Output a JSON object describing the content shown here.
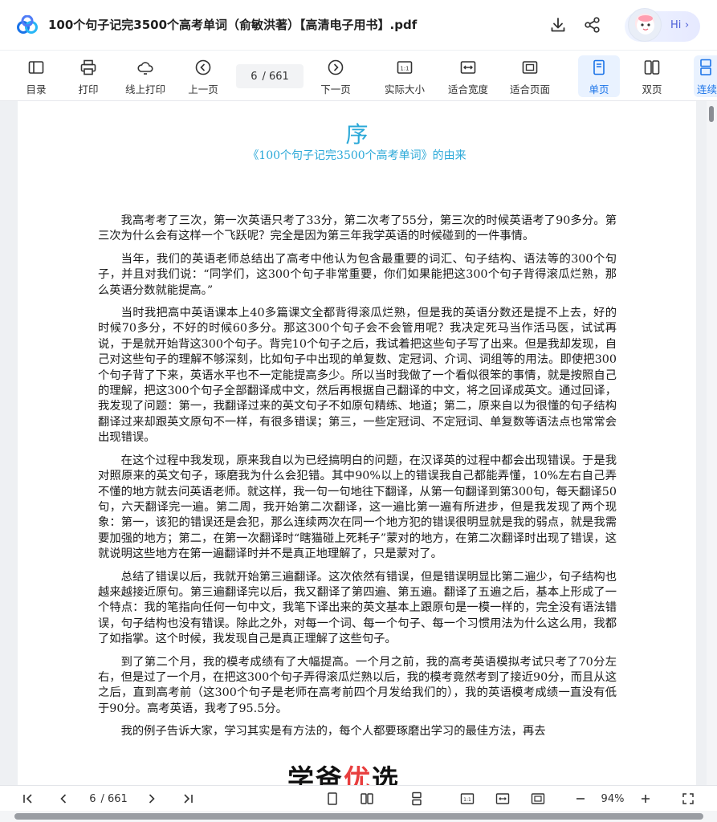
{
  "titlebar": {
    "title": "100个句子记完3500个高考单词（俞敏洪著）【高清电子用书】.pdf",
    "hi_label": "Hi",
    "hi_chevron": "›"
  },
  "toolbar": {
    "tools": [
      {
        "label": "目录",
        "icon": "toc-icon"
      },
      {
        "label": "打印",
        "icon": "printer-icon"
      },
      {
        "label": "线上打印",
        "icon": "cloud-print-icon"
      },
      {
        "label": "上一页",
        "icon": "prev-page-icon"
      },
      {
        "label": "下一页",
        "icon": "next-page-icon"
      },
      {
        "label": "实际大小",
        "icon": "actual-size-icon"
      },
      {
        "label": "适合宽度",
        "icon": "fit-width-icon"
      },
      {
        "label": "适合页面",
        "icon": "fit-page-icon"
      },
      {
        "label": "单页",
        "icon": "single-page-icon"
      },
      {
        "label": "双页",
        "icon": "double-page-icon"
      },
      {
        "label": "连续",
        "icon": "continuous-icon"
      }
    ],
    "current_page": "6",
    "total_pages": "/ 661",
    "active_tool": "单页"
  },
  "page": {
    "heading": "序",
    "subheading": "《100个句子记完3500个高考单词》的由来",
    "paragraphs": [
      "我高考考了三次，第一次英语只考了33分，第二次考了55分，第三次的时候英语考了90多分。第三次为什么会有这样一个飞跃呢？完全是因为第三年我学英语的时候碰到的一件事情。",
      "当年，我们的英语老师总结出了高考中他认为包含最重要的词汇、句子结构、语法等的300个句子，并且对我们说：“同学们，这300个句子非常重要，你们如果能把这300个句子背得滚瓜烂熟，那么英语分数就能提高。”",
      "当时我把高中英语课本上40多篇课文全都背得滚瓜烂熟，但是我的英语分数还是提不上去，好的时候70多分，不好的时候60多分。那这300个句子会不会管用呢？我决定死马当作活马医，试试再说，于是就开始背这300个句子。背完10个句子之后，我试着把这些句子写了出来。但是我却发现，自己对这些句子的理解不够深刻，比如句子中出现的单复数、定冠词、介词、词组等的用法。即使把300个句子背了下来，英语水平也不一定能提高多少。所以当时我做了一个看似很笨的事情，就是按照自己的理解，把这300个句子全部翻译成中文，然后再根据自己翻译的中文，将之回译成英文。通过回译，我发现了问题：第一，我翻译过来的英文句子不如原句精练、地道；第二，原来自以为很懂的句子结构翻译过来却跟英文原句不一样，有很多错误；第三，一些定冠词、不定冠词、单复数等语法点也常常会出现错误。",
      "在这个过程中我发现，原来我自以为已经搞明白的问题，在汉译英的过程中都会出现错误。于是我对照原来的英文句子，琢磨我为什么会犯错。其中90%以上的错误我自己都能弄懂，10%左右自己弄不懂的地方就去问英语老师。就这样，我一句一句地往下翻译，从第一句翻译到第300句，每天翻译50句，六天翻译完一遍。第二周，我开始第二次翻译，这一遍比第一遍有所进步，但是我发现了两个现象：第一，该犯的错误还是会犯，那么连续两次在同一个地方犯的错误很明显就是我的弱点，就是我需要加强的地方；第二，在第一次翻译时“瞎猫碰上死耗子”蒙对的地方，在第二次翻译时出现了错误，这就说明这些地方在第一遍翻译时并不是真正地理解了，只是蒙对了。",
      "总结了错误以后，我就开始第三遍翻译。这次依然有错误，但是错误明显比第二遍少，句子结构也越来越接近原句。第三遍翻译完以后，我又翻译了第四遍、第五遍。翻译了五遍之后，基本上形成了一个特点：我的笔指向任何一句中文，我笔下译出来的英文基本上跟原句是一模一样的，完全没有语法错误，句子结构也没有错误。除此之外，对每一个词、每一个句子、每一个习惯用法为什么这么用，我都了如指掌。这个时候，我发现自己是真正理解了这些句子。",
      "到了第二个月，我的模考成绩有了大幅提高。一个月之前，我的高考英语模拟考试只考了70分左右，但是过了一个月，在把这300个句子弄得滚瓜烂熟以后，我的模考竟然考到了接近90分，而且从这之后，直到高考前（这300个句子是老师在高考前四个月发给我们的），我的英语模考成绩一直没有低于90分。高考英语，我考了95.5分。",
      "我的例子告诉大家，学习其实是有方法的，每个人都要琢磨出学习的最佳方法，再去"
    ],
    "watermark_plain": "学爸",
    "watermark_accent": "优",
    "watermark_tail": "选"
  },
  "bottombar": {
    "current_page": "6",
    "total_pages": "/ 661",
    "zoom": "94%"
  },
  "colors": {
    "accent": "#1a73e8",
    "heading": "#2aa8d8",
    "watermark_accent": "#e83e3e"
  }
}
